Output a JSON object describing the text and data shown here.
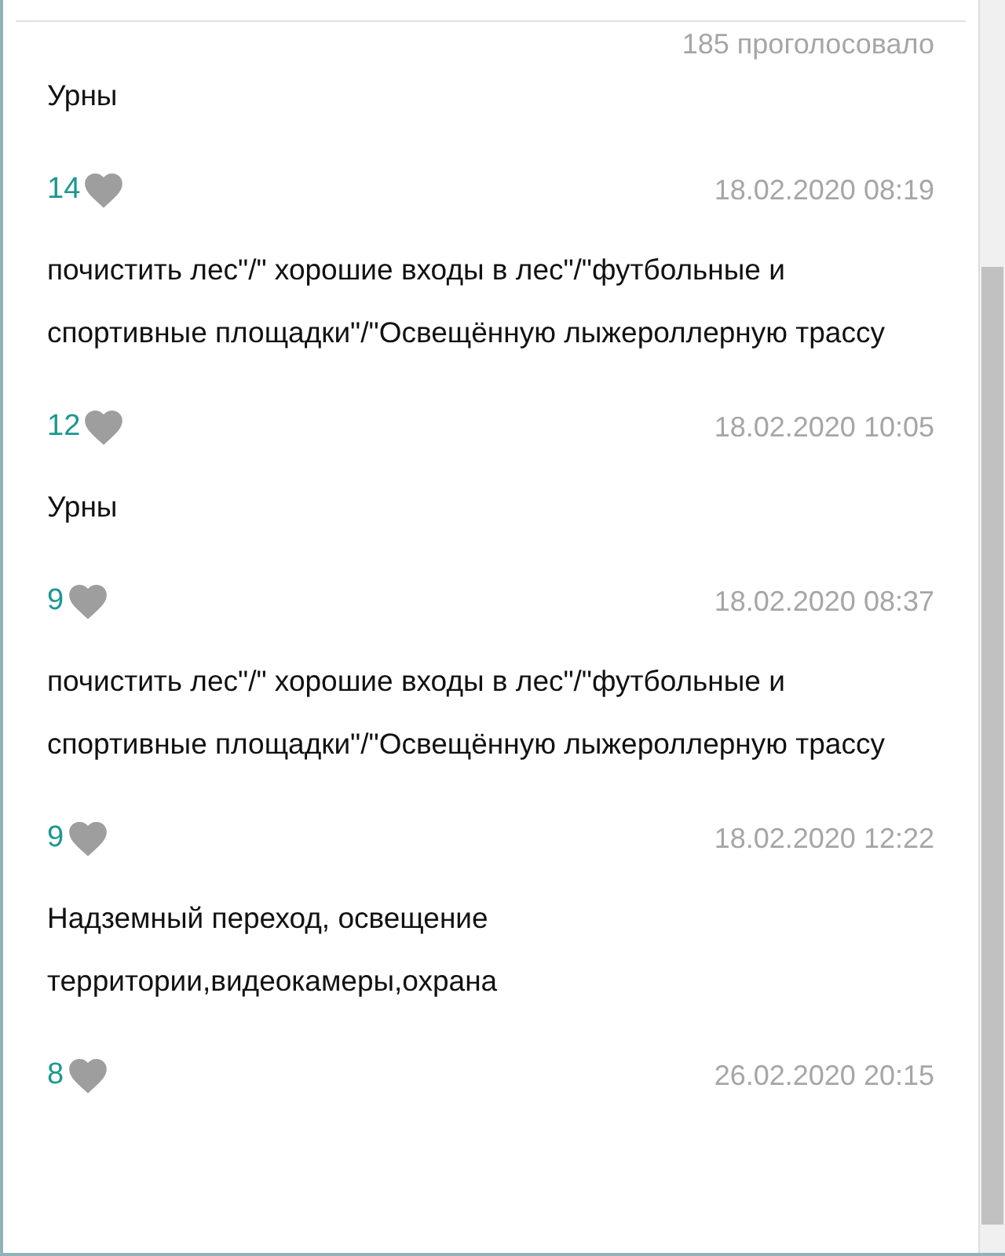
{
  "poll": {
    "votes": "185 проголосовало",
    "answer": "Урны"
  },
  "comments": [
    {
      "likes": "14",
      "date": "18.02.2020 08:19",
      "text": "почистить лес\"/\" хорошие входы в лес\"/\"футбольные и спортивные площадки\"/\"Освещённую лыжероллерную трассу"
    },
    {
      "likes": "12",
      "date": "18.02.2020 10:05",
      "text": "Урны"
    },
    {
      "likes": "9",
      "date": "18.02.2020 08:37",
      "text": "почистить лес\"/\" хорошие входы в лес\"/\"футбольные и спортивные площадки\"/\"Освещённую лыжероллерную трассу"
    },
    {
      "likes": "9",
      "date": "18.02.2020 12:22",
      "text": "Надземный переход, освещение территории,видеокамеры,охрана"
    },
    {
      "likes": "8",
      "date": "26.02.2020 20:15"
    }
  ]
}
